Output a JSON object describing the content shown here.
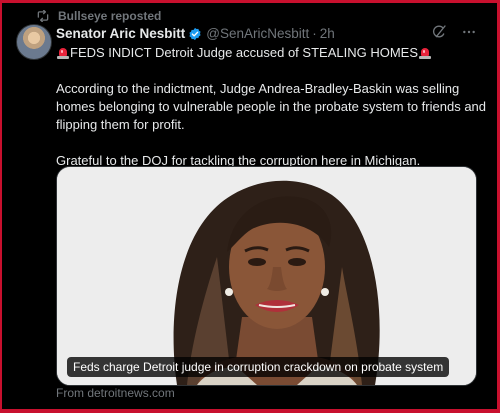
{
  "repost": {
    "label": "Bullseye reposted"
  },
  "author": {
    "name": "Senator Aric Nesbitt",
    "handle": "@SenAricNesbitt",
    "separator": "·",
    "time": "2h"
  },
  "tweet": {
    "headline": "FEDS INDICT Detroit Judge accused of STEALING HOMES",
    "paragraph2": "According to the indictment, Judge Andrea-Bradley-Baskin was selling homes belonging to vulnerable people in the probate system to friends and flipping them for profit.",
    "paragraph3": "Grateful to the DOJ for tackling the corruption here in Michigan."
  },
  "media": {
    "caption": "Feds charge Detroit judge in corruption crackdown on probate system",
    "source": "From detroitnews.com"
  },
  "icons": {
    "repost": "repost-icon",
    "verified": "verified-badge-icon",
    "siren": "police-siren-emoji",
    "grok": "grok-icon",
    "more": "more-dots-icon"
  },
  "colors": {
    "background": "#000000",
    "text": "#e7e9ea",
    "muted": "#71767b",
    "verified": "#1d9bf0",
    "frame": "#c8102e"
  }
}
